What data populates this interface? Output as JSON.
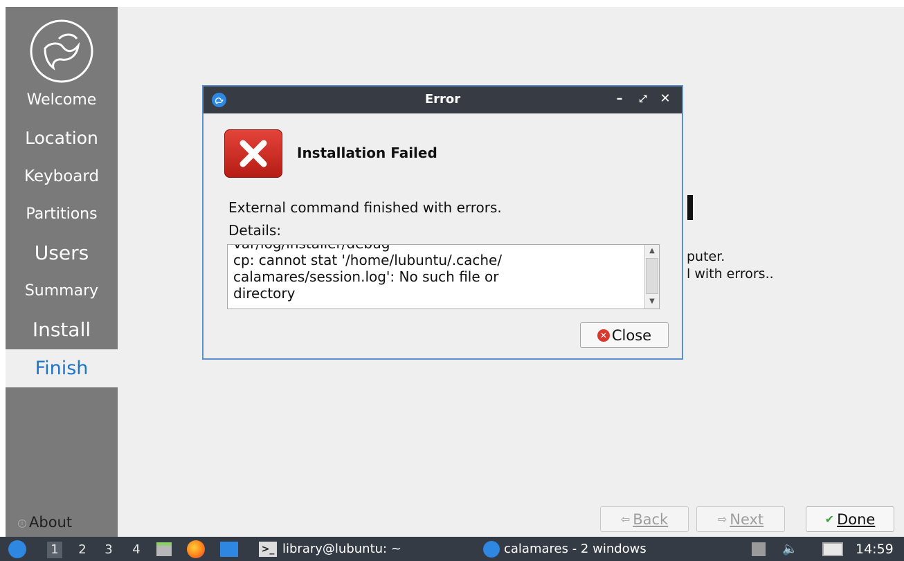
{
  "sidebar": {
    "steps": [
      {
        "label": "Welcome"
      },
      {
        "label": "Location"
      },
      {
        "label": "Keyboard"
      },
      {
        "label": "Partitions"
      },
      {
        "label": "Users"
      },
      {
        "label": "Summary"
      },
      {
        "label": "Install"
      },
      {
        "label": "Finish"
      }
    ],
    "about_label": "About"
  },
  "background": {
    "line1": "puter.",
    "line2": "l with errors.."
  },
  "nav": {
    "back_label": "Back",
    "next_label": "Next",
    "done_label": "Done"
  },
  "dialog": {
    "title": "Error",
    "heading": "Installation Failed",
    "message": "External command finished with errors.",
    "details_label": "Details:",
    "details_lines": [
      "var/log/installer/debug",
      "cp: cannot stat '/home/lubuntu/.cache/",
      "calamares/session.log': No such file or",
      "directory"
    ],
    "close_label": "Close"
  },
  "taskbar": {
    "workspaces": [
      "1",
      "2",
      "3",
      "4"
    ],
    "active_workspace": "1",
    "terminal_task": "library@lubuntu: ~",
    "calamares_task": "calamares - 2 windows",
    "clock": "14:59"
  },
  "colors": {
    "sidebar_bg": "#7a7a7a",
    "active_step": "#1f74c7",
    "titlebar": "#373c44",
    "taskbar": "#353b44",
    "error_red": "#d32f2f"
  }
}
